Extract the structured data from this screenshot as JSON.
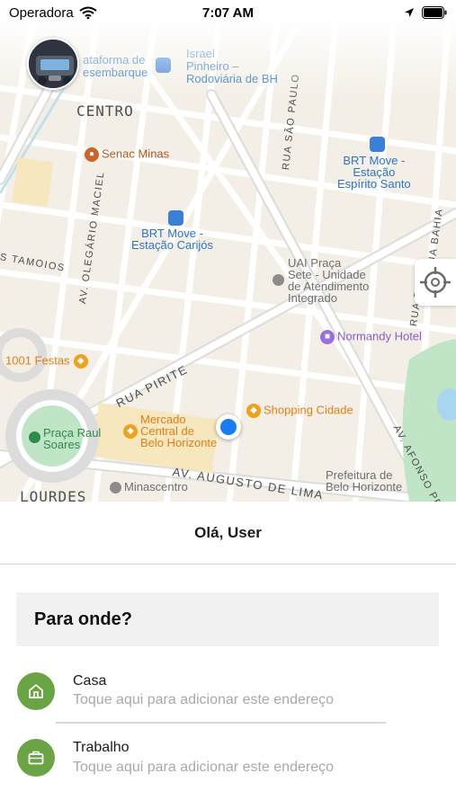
{
  "status_bar": {
    "carrier": "Operadora",
    "time": "7:07 AM"
  },
  "map": {
    "district_centro": "CENTRO",
    "district_lourdes": "LOURDES",
    "pois": {
      "plataforma": [
        "ataforma de",
        "esembarque"
      ],
      "israel_pinheiro": [
        "Israel",
        "Pinheiro –",
        "Rodoviária de BH"
      ],
      "senac": "Senac Minas",
      "brt_espirito_santo": [
        "BRT Move -",
        "Estação",
        "Espírito Santo"
      ],
      "brt_carijos": [
        "BRT Move -",
        "Estação Carijós"
      ],
      "uai": [
        "UAI Praça",
        "Sete - Unidade",
        "de Atendimento",
        "Integrado"
      ],
      "normandy": "Normandy Hotel",
      "festas": "1001 Festas",
      "shopping": "Shopping Cidade",
      "mercado": [
        "Mercado",
        "Central de",
        "Belo Horizonte"
      ],
      "praca": [
        "Praça Raul",
        "Soares"
      ],
      "minascentro": "Minascentro",
      "prefeitura": [
        "Prefeitura de",
        "Belo Horizonte"
      ]
    },
    "streets": {
      "sao_paulo": "RUA SÃO PAULO",
      "tamoios": "S TAMOIOS",
      "olegario": "AV. OLEGÁRIO MACIEL",
      "pirite": "RUA PIRITE",
      "augusto": "AV. AUGUSTO DE LIMA",
      "afonso": "AV. AFONSO PENA",
      "bahia": "RUA BAHIA",
      "rua_r": "RUA R"
    }
  },
  "panel": {
    "greeting": "Olá, User",
    "where_to": "Para onde?",
    "addresses": [
      {
        "title": "Casa",
        "subtitle": "Toque aqui para adicionar este endereço",
        "icon": "home-icon"
      },
      {
        "title": "Trabalho",
        "subtitle": "Toque aqui para adicionar este endereço",
        "icon": "briefcase-icon"
      }
    ]
  },
  "colors": {
    "accent_green": "#6aa444",
    "user_location_blue": "#1a7cf2",
    "poi_orange": "#e07f16",
    "transit_blue": "#2e74c9"
  }
}
